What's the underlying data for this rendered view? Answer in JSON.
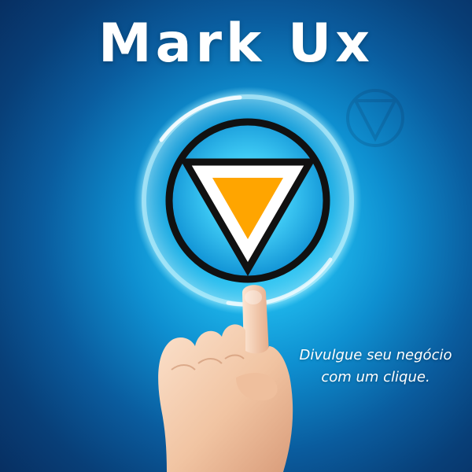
{
  "brand": {
    "title": "Mark Ux"
  },
  "tagline": {
    "line1": "Divulgue seu negócio",
    "line2": "com um clique."
  },
  "colors": {
    "accent": "#ffa500",
    "ring": "#111111",
    "background": "#1aa9e6"
  },
  "icons": {
    "logo": "triangle-badge-icon",
    "ghost_logo": "triangle-badge-outline-icon",
    "hand": "pointing-hand-image"
  }
}
